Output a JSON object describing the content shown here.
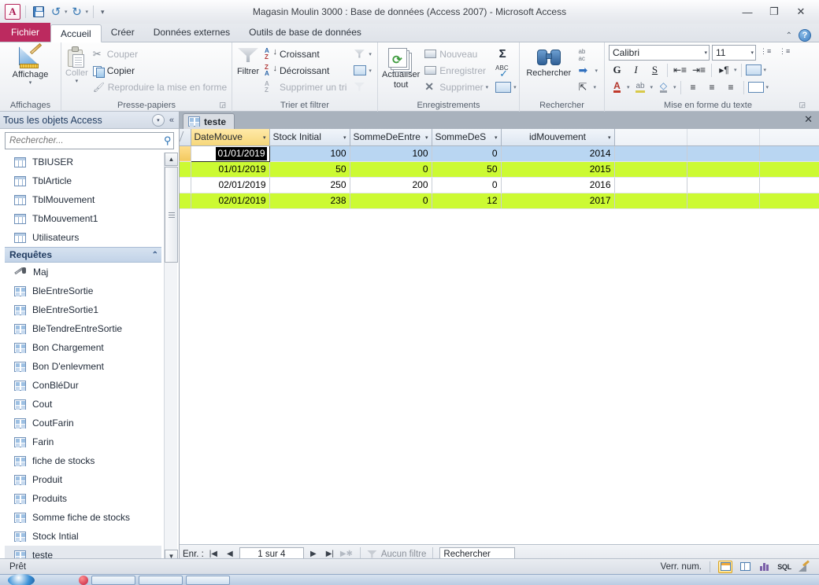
{
  "window": {
    "title": "Magasin Moulin 3000 : Base de données (Access 2007)  -  Microsoft Access",
    "logo": "A",
    "minimize": "—",
    "restore": "❐",
    "close": "✕"
  },
  "quick_access": {
    "save_tip": "Enregistrer",
    "undo": "↺",
    "redo": "↻",
    "more": "▾"
  },
  "tabs": [
    {
      "label": "Fichier",
      "name": "tab-fichier"
    },
    {
      "label": "Accueil",
      "name": "tab-accueil"
    },
    {
      "label": "Créer",
      "name": "tab-creer"
    },
    {
      "label": "Données externes",
      "name": "tab-donnees-externes"
    },
    {
      "label": "Outils de base de données",
      "name": "tab-outils-bdd"
    }
  ],
  "ribbon": {
    "collapse_glyph": "⌃",
    "help_glyph": "?",
    "groups": {
      "affichages": {
        "label": "Affichages",
        "view_button": "Affichage",
        "caret": "▾"
      },
      "presse_papiers": {
        "label": "Presse-papiers",
        "paste": "Coller",
        "paste_caret": "▾",
        "cut": "Couper",
        "copy": "Copier",
        "format_painter": "Reproduire la mise en forme",
        "dialog_launcher": "◲"
      },
      "trier_filtrer": {
        "label": "Trier et filtrer",
        "filter": "Filtrer",
        "ascending": "Croissant",
        "descending": "Décroissant",
        "remove_sort": "Supprimer un tri",
        "advanced_caret": "▾",
        "selection_caret": "▾"
      },
      "enregistrements": {
        "label": "Enregistrements",
        "refresh_all": "Actualiser",
        "refresh_all_2": "tout",
        "refresh_caret": "▾",
        "new": "Nouveau",
        "save": "Enregistrer",
        "delete": "Supprimer",
        "delete_caret": "▾",
        "totals": "Σ",
        "spelling": "ABC",
        "more_caret": "▾"
      },
      "rechercher": {
        "label": "Rechercher",
        "find": "Rechercher",
        "replace": "ab\\nac",
        "goto_caret": "▾",
        "select_caret": "▾"
      },
      "mise_en_forme": {
        "label": "Mise en forme du texte",
        "font_name": "Calibri",
        "font_size": "11",
        "caret": "▾",
        "bold": "G",
        "italic": "I",
        "underline": "S",
        "dialog_launcher": "◲"
      }
    }
  },
  "navigation_pane": {
    "title": "Tous les objets Access",
    "drop_glyph": "▾",
    "collapse_glyph": "«",
    "search_placeholder": "Rechercher...",
    "tables": [
      {
        "label": "TBIUSER",
        "icon": "table-icon"
      },
      {
        "label": "TblArticle",
        "icon": "table-icon"
      },
      {
        "label": "TblMouvement",
        "icon": "table-icon"
      },
      {
        "label": "TbMouvement1",
        "icon": "table-icon"
      },
      {
        "label": "Utilisateurs",
        "icon": "table-icon"
      }
    ],
    "queries_group": {
      "label": "Requêtes",
      "chevron": "⌃"
    },
    "queries": [
      {
        "label": "Maj",
        "icon": "update-query-icon"
      },
      {
        "label": "BleEntreSortie",
        "icon": "query-icon"
      },
      {
        "label": "BleEntreSortie1",
        "icon": "query-icon"
      },
      {
        "label": "BleTendreEntreSortie",
        "icon": "query-icon"
      },
      {
        "label": "Bon Chargement",
        "icon": "query-icon"
      },
      {
        "label": "Bon D'enlevment",
        "icon": "query-icon"
      },
      {
        "label": "ConBléDur",
        "icon": "query-icon"
      },
      {
        "label": "Cout",
        "icon": "query-icon"
      },
      {
        "label": "CoutFarin",
        "icon": "query-icon"
      },
      {
        "label": "Farin",
        "icon": "query-icon"
      },
      {
        "label": "fiche de stocks",
        "icon": "query-icon"
      },
      {
        "label": "Produit",
        "icon": "query-icon"
      },
      {
        "label": "Produits",
        "icon": "query-icon"
      },
      {
        "label": "Somme fiche de stocks",
        "icon": "query-icon"
      },
      {
        "label": "Stock Intial",
        "icon": "query-icon"
      },
      {
        "label": "teste",
        "icon": "query-icon"
      }
    ],
    "scroll_up": "▲",
    "scroll_down": "▼"
  },
  "document": {
    "tab_label": "teste",
    "close_glyph": "✕",
    "columns": [
      {
        "label": "DateMouve",
        "caret": "▾",
        "align": "right",
        "selected": true
      },
      {
        "label": "Stock Initial",
        "caret": "▾",
        "align": "right",
        "selected": false
      },
      {
        "label": "SommeDeEntre",
        "caret": "▾",
        "align": "right",
        "selected": false
      },
      {
        "label": "SommeDeS",
        "caret": "▾",
        "align": "right",
        "selected": false
      },
      {
        "label": "idMouvement",
        "caret": "▾",
        "align": "right",
        "selected": false
      }
    ],
    "rows": [
      {
        "style": "r-blue",
        "current": true,
        "editing_col": 0,
        "cells": [
          "01/01/2019",
          "100",
          "100",
          "0",
          "2014"
        ]
      },
      {
        "style": "r-green",
        "current": false,
        "editing_col": -1,
        "cells": [
          "01/01/2019",
          "50",
          "0",
          "50",
          "2015"
        ]
      },
      {
        "style": "r-white",
        "current": false,
        "editing_col": -1,
        "cells": [
          "02/01/2019",
          "250",
          "200",
          "0",
          "2016"
        ]
      },
      {
        "style": "r-green",
        "current": false,
        "editing_col": -1,
        "cells": [
          "02/01/2019",
          "238",
          "0",
          "12",
          "2017"
        ]
      }
    ],
    "record_nav": {
      "label": "Enr. :",
      "first": "|◀",
      "prev": "◀",
      "position": "1 sur 4",
      "next": "▶",
      "last": "▶|",
      "new_record": "▶✱",
      "filter_status": "Aucun filtre",
      "search_value": "Rechercher"
    }
  },
  "status_bar": {
    "state": "Prêt",
    "num_lock": "Verr. num.",
    "views": [
      {
        "name": "datasheet-view",
        "active": true
      },
      {
        "name": "pivottable-view",
        "active": false
      },
      {
        "name": "pivotchart-view",
        "active": false
      },
      {
        "name": "sql-view",
        "label": "SQL",
        "active": false
      },
      {
        "name": "design-view",
        "active": false
      }
    ]
  },
  "colors": {
    "accent_file_tab": "#bc2a5f",
    "selected_row": "#b9d6f2",
    "highlight_row": "#ccfa33",
    "selected_column_header": "#f6d77a",
    "nav_group_header": "#c2d3e8"
  }
}
